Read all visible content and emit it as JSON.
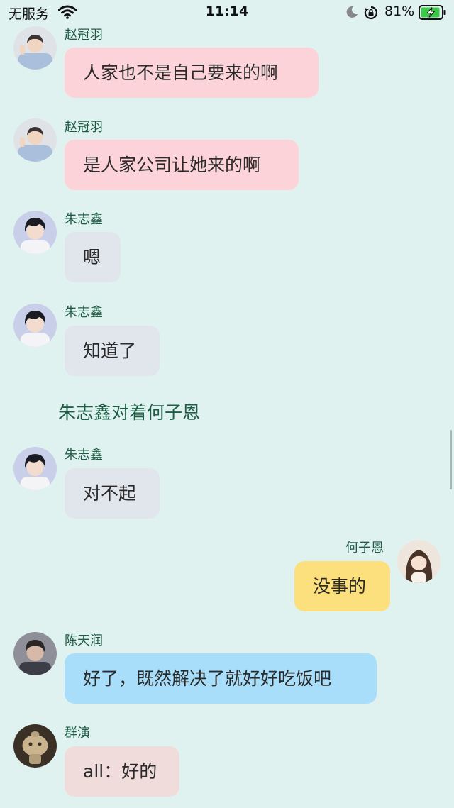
{
  "status_bar": {
    "carrier": "无服务",
    "time": "11:14",
    "battery_percent": "81%",
    "icons": [
      "wifi-icon",
      "moon-icon",
      "orientation-lock-icon",
      "battery-charging-icon"
    ]
  },
  "colors": {
    "background": "#e0f2f0",
    "sender_name": "#1e5c44",
    "bubble_zhao": "#fdd3da",
    "bubble_zhu": "#e1e5ec",
    "bubble_he": "#fde07e",
    "bubble_chen": "#a9defa",
    "bubble_crowd": "#f1dcdc"
  },
  "messages": [
    {
      "sender": "赵冠羽",
      "text": "人家也不是自己要来的啊",
      "side": "left"
    },
    {
      "sender": "赵冠羽",
      "text": "是人家公司让她来的啊",
      "side": "left"
    },
    {
      "sender": "朱志鑫",
      "text": "嗯",
      "side": "left"
    },
    {
      "sender": "朱志鑫",
      "text": "知道了",
      "side": "left"
    },
    {
      "sender": "朱志鑫",
      "text": "对不起",
      "side": "left"
    },
    {
      "sender": "何子恩",
      "text": "没事的",
      "side": "right"
    },
    {
      "sender": "陈天润",
      "text": "好了，既然解决了就好好吃饭吧",
      "side": "left"
    },
    {
      "sender": "群演",
      "text": "all：好的",
      "side": "left"
    }
  ],
  "narration": "朱志鑫对着何子恩"
}
